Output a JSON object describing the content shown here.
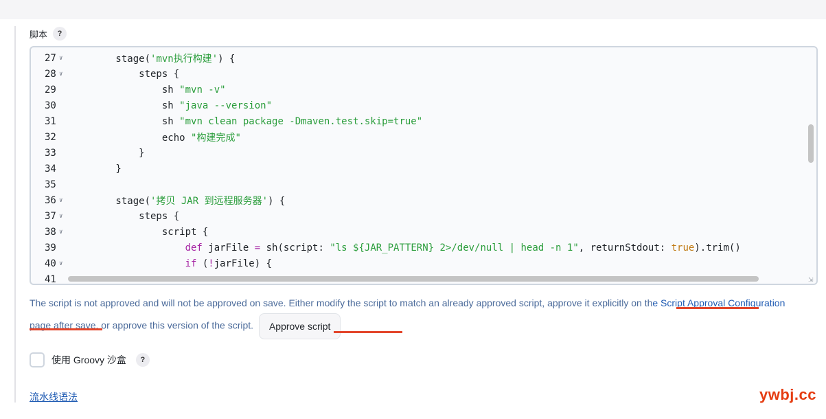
{
  "field": {
    "label": "脚本",
    "help": "?"
  },
  "editor": {
    "lines": [
      {
        "num": "27",
        "fold": true,
        "segments": [
          [
            "p",
            "        stage("
          ],
          [
            "s",
            "'mvn执行构建'"
          ],
          [
            "p",
            ") {"
          ]
        ]
      },
      {
        "num": "28",
        "fold": true,
        "segments": [
          [
            "p",
            "            steps {"
          ]
        ]
      },
      {
        "num": "29",
        "fold": false,
        "segments": [
          [
            "p",
            "                sh "
          ],
          [
            "s",
            "\"mvn -v\""
          ]
        ]
      },
      {
        "num": "30",
        "fold": false,
        "segments": [
          [
            "p",
            "                sh "
          ],
          [
            "s",
            "\"java --version\""
          ]
        ]
      },
      {
        "num": "31",
        "fold": false,
        "segments": [
          [
            "p",
            "                sh "
          ],
          [
            "s",
            "\"mvn clean package -Dmaven.test.skip=true\""
          ]
        ]
      },
      {
        "num": "32",
        "fold": false,
        "segments": [
          [
            "p",
            "                echo "
          ],
          [
            "s",
            "\"构建完成\""
          ]
        ]
      },
      {
        "num": "33",
        "fold": false,
        "segments": [
          [
            "p",
            "            }"
          ]
        ]
      },
      {
        "num": "34",
        "fold": false,
        "segments": [
          [
            "p",
            "        }"
          ]
        ]
      },
      {
        "num": "35",
        "fold": false,
        "segments": [
          [
            "p",
            ""
          ]
        ]
      },
      {
        "num": "36",
        "fold": true,
        "segments": [
          [
            "p",
            "        stage("
          ],
          [
            "s",
            "'拷贝 JAR 到远程服务器'"
          ],
          [
            "p",
            ") {"
          ]
        ]
      },
      {
        "num": "37",
        "fold": true,
        "segments": [
          [
            "p",
            "            steps {"
          ]
        ]
      },
      {
        "num": "38",
        "fold": true,
        "segments": [
          [
            "p",
            "                script {"
          ]
        ]
      },
      {
        "num": "39",
        "fold": false,
        "segments": [
          [
            "k",
            "                    def"
          ],
          [
            "p",
            " jarFile "
          ],
          [
            "k",
            "="
          ],
          [
            "p",
            " sh(script: "
          ],
          [
            "s",
            "\"ls ${JAR_PATTERN} 2>/dev/null | head -n 1\""
          ],
          [
            "p",
            ", returnStdout: "
          ],
          [
            "b",
            "true"
          ],
          [
            "p",
            ").trim()"
          ]
        ]
      },
      {
        "num": "40",
        "fold": true,
        "segments": [
          [
            "k",
            "                    if"
          ],
          [
            "p",
            " ("
          ],
          [
            "k",
            "!"
          ],
          [
            "p",
            "jarFile) {"
          ]
        ]
      },
      {
        "num": "41",
        "fold": false,
        "segments": [
          [
            "p",
            ""
          ]
        ]
      }
    ]
  },
  "warning": {
    "text_before": "The script is not approved and will not be approved on save. Either modify the script to match an already approved script, approve it explicitly on th",
    "link_text": "e Script Approval Configuration",
    "text_after": " page after save, or approve this version of the script.",
    "approve_button": "Approve script"
  },
  "sandbox": {
    "label": "使用 Groovy 沙盒",
    "help": "?"
  },
  "pipeline_syntax_link": "流水线语法",
  "watermark": "ywbj.cc",
  "colors": {
    "string": "#2a9d3b",
    "keyword": "#a626a4",
    "boolean": "#c07a14",
    "link": "#1f5bb3",
    "underline": "#e3452a"
  }
}
